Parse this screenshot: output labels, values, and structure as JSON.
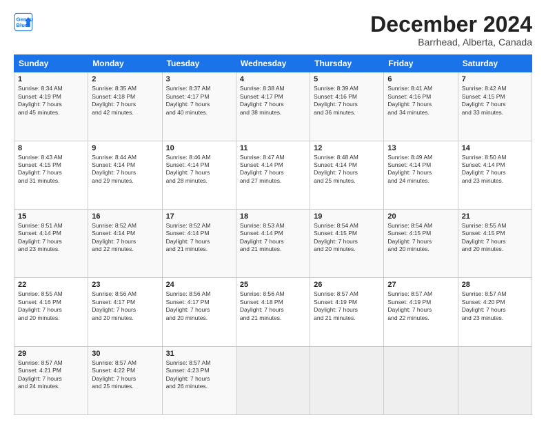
{
  "logo": {
    "line1": "General",
    "line2": "Blue"
  },
  "title": "December 2024",
  "subtitle": "Barrhead, Alberta, Canada",
  "weekdays": [
    "Sunday",
    "Monday",
    "Tuesday",
    "Wednesday",
    "Thursday",
    "Friday",
    "Saturday"
  ],
  "weeks": [
    [
      {
        "day": "1",
        "info": "Sunrise: 8:34 AM\nSunset: 4:19 PM\nDaylight: 7 hours\nand 45 minutes."
      },
      {
        "day": "2",
        "info": "Sunrise: 8:35 AM\nSunset: 4:18 PM\nDaylight: 7 hours\nand 42 minutes."
      },
      {
        "day": "3",
        "info": "Sunrise: 8:37 AM\nSunset: 4:17 PM\nDaylight: 7 hours\nand 40 minutes."
      },
      {
        "day": "4",
        "info": "Sunrise: 8:38 AM\nSunset: 4:17 PM\nDaylight: 7 hours\nand 38 minutes."
      },
      {
        "day": "5",
        "info": "Sunrise: 8:39 AM\nSunset: 4:16 PM\nDaylight: 7 hours\nand 36 minutes."
      },
      {
        "day": "6",
        "info": "Sunrise: 8:41 AM\nSunset: 4:16 PM\nDaylight: 7 hours\nand 34 minutes."
      },
      {
        "day": "7",
        "info": "Sunrise: 8:42 AM\nSunset: 4:15 PM\nDaylight: 7 hours\nand 33 minutes."
      }
    ],
    [
      {
        "day": "8",
        "info": "Sunrise: 8:43 AM\nSunset: 4:15 PM\nDaylight: 7 hours\nand 31 minutes."
      },
      {
        "day": "9",
        "info": "Sunrise: 8:44 AM\nSunset: 4:14 PM\nDaylight: 7 hours\nand 29 minutes."
      },
      {
        "day": "10",
        "info": "Sunrise: 8:46 AM\nSunset: 4:14 PM\nDaylight: 7 hours\nand 28 minutes."
      },
      {
        "day": "11",
        "info": "Sunrise: 8:47 AM\nSunset: 4:14 PM\nDaylight: 7 hours\nand 27 minutes."
      },
      {
        "day": "12",
        "info": "Sunrise: 8:48 AM\nSunset: 4:14 PM\nDaylight: 7 hours\nand 25 minutes."
      },
      {
        "day": "13",
        "info": "Sunrise: 8:49 AM\nSunset: 4:14 PM\nDaylight: 7 hours\nand 24 minutes."
      },
      {
        "day": "14",
        "info": "Sunrise: 8:50 AM\nSunset: 4:14 PM\nDaylight: 7 hours\nand 23 minutes."
      }
    ],
    [
      {
        "day": "15",
        "info": "Sunrise: 8:51 AM\nSunset: 4:14 PM\nDaylight: 7 hours\nand 23 minutes."
      },
      {
        "day": "16",
        "info": "Sunrise: 8:52 AM\nSunset: 4:14 PM\nDaylight: 7 hours\nand 22 minutes."
      },
      {
        "day": "17",
        "info": "Sunrise: 8:52 AM\nSunset: 4:14 PM\nDaylight: 7 hours\nand 21 minutes."
      },
      {
        "day": "18",
        "info": "Sunrise: 8:53 AM\nSunset: 4:14 PM\nDaylight: 7 hours\nand 21 minutes."
      },
      {
        "day": "19",
        "info": "Sunrise: 8:54 AM\nSunset: 4:15 PM\nDaylight: 7 hours\nand 20 minutes."
      },
      {
        "day": "20",
        "info": "Sunrise: 8:54 AM\nSunset: 4:15 PM\nDaylight: 7 hours\nand 20 minutes."
      },
      {
        "day": "21",
        "info": "Sunrise: 8:55 AM\nSunset: 4:15 PM\nDaylight: 7 hours\nand 20 minutes."
      }
    ],
    [
      {
        "day": "22",
        "info": "Sunrise: 8:55 AM\nSunset: 4:16 PM\nDaylight: 7 hours\nand 20 minutes."
      },
      {
        "day": "23",
        "info": "Sunrise: 8:56 AM\nSunset: 4:17 PM\nDaylight: 7 hours\nand 20 minutes."
      },
      {
        "day": "24",
        "info": "Sunrise: 8:56 AM\nSunset: 4:17 PM\nDaylight: 7 hours\nand 20 minutes."
      },
      {
        "day": "25",
        "info": "Sunrise: 8:56 AM\nSunset: 4:18 PM\nDaylight: 7 hours\nand 21 minutes."
      },
      {
        "day": "26",
        "info": "Sunrise: 8:57 AM\nSunset: 4:19 PM\nDaylight: 7 hours\nand 21 minutes."
      },
      {
        "day": "27",
        "info": "Sunrise: 8:57 AM\nSunset: 4:19 PM\nDaylight: 7 hours\nand 22 minutes."
      },
      {
        "day": "28",
        "info": "Sunrise: 8:57 AM\nSunset: 4:20 PM\nDaylight: 7 hours\nand 23 minutes."
      }
    ],
    [
      {
        "day": "29",
        "info": "Sunrise: 8:57 AM\nSunset: 4:21 PM\nDaylight: 7 hours\nand 24 minutes."
      },
      {
        "day": "30",
        "info": "Sunrise: 8:57 AM\nSunset: 4:22 PM\nDaylight: 7 hours\nand 25 minutes."
      },
      {
        "day": "31",
        "info": "Sunrise: 8:57 AM\nSunset: 4:23 PM\nDaylight: 7 hours\nand 26 minutes."
      },
      null,
      null,
      null,
      null
    ]
  ]
}
